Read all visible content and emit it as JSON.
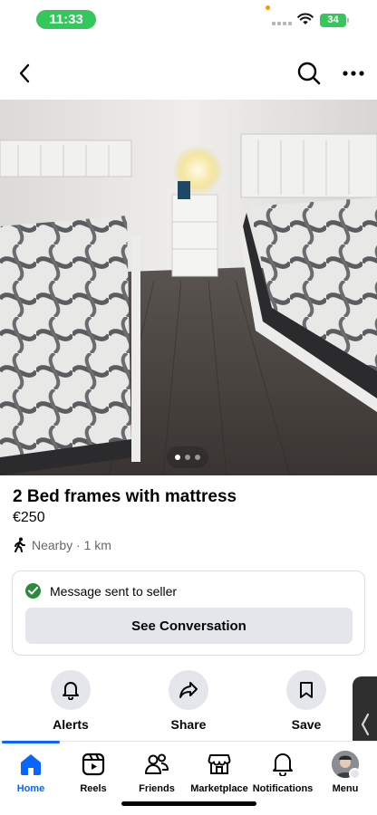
{
  "status_bar": {
    "time": "11:33",
    "battery": "34",
    "time_pill_color": "#34c759"
  },
  "top_nav": {
    "back_icon": "chevron-left-icon",
    "search_icon": "search-icon",
    "more_icon": "more-horizontal-icon"
  },
  "listing": {
    "photo_count": 3,
    "active_photo_index": 0,
    "title": "2 Bed frames with mattress",
    "price": "€250",
    "location": "Nearby · 1 km"
  },
  "message_card": {
    "status_text": "Message sent to seller",
    "button_label": "See Conversation"
  },
  "actions": [
    {
      "label": "Alerts",
      "icon": "bell-icon"
    },
    {
      "label": "Share",
      "icon": "share-arrow-icon"
    },
    {
      "label": "Save",
      "icon": "bookmark-icon"
    }
  ],
  "bottom_nav": {
    "items": [
      {
        "label": "Home",
        "icon": "home-icon",
        "active": true
      },
      {
        "label": "Reels",
        "icon": "reels-icon",
        "active": false
      },
      {
        "label": "Friends",
        "icon": "friends-icon",
        "active": false
      },
      {
        "label": "Marketplace",
        "icon": "marketplace-icon",
        "active": false
      },
      {
        "label": "Notifications",
        "icon": "bell-icon",
        "active": false
      },
      {
        "label": "Menu",
        "icon": "avatar",
        "active": false
      }
    ]
  },
  "colors": {
    "accent": "#0866ff",
    "check": "#2e8b3e",
    "button_bg": "#e4e6eb"
  }
}
